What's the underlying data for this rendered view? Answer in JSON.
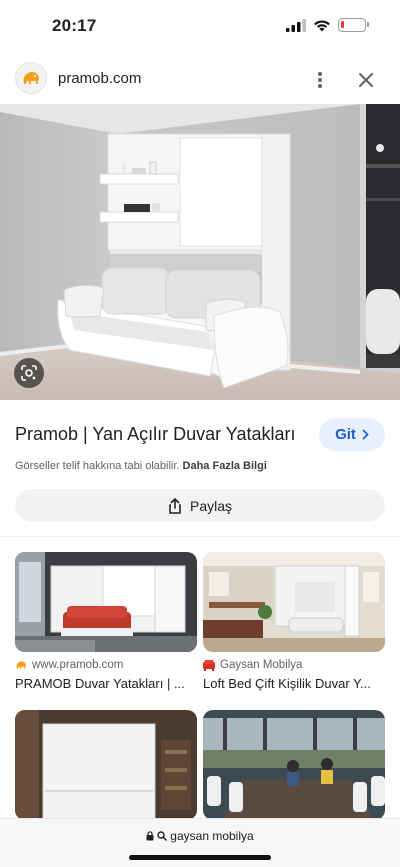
{
  "status_bar": {
    "time": "20:17",
    "battery_level": 0.12,
    "battery_color": "#ff3b30"
  },
  "header": {
    "site_domain": "pramob.com",
    "favicon_icon": "pramob-elephant-logo",
    "more_icon": "more-vertical-icon",
    "close_icon": "close-icon"
  },
  "result": {
    "title": "Pramob | Yan Açılır Duvar Yatakları",
    "visit_label": "Git",
    "copyright_note": "Görseller telif hakkına tabi olabilir.",
    "learn_more": "Daha Fazla Bilgi",
    "share_label": "Paylaş"
  },
  "related": [
    {
      "source": "www.pramob.com",
      "title": "PRAMOB Duvar Yatakları | ...",
      "source_color": "#f4a21d"
    },
    {
      "source": "Gaysan Mobilya",
      "title": "Loft Bed Çift Kişilik Duvar Y...",
      "source_color": "#d93025"
    },
    {
      "source": "",
      "title": ""
    },
    {
      "source": "",
      "title": ""
    }
  ],
  "bottom_bar": {
    "url": "gaysan mobilya"
  },
  "colors": {
    "accent": "#1a5fc8",
    "visit_bg": "#e8f0fe"
  }
}
